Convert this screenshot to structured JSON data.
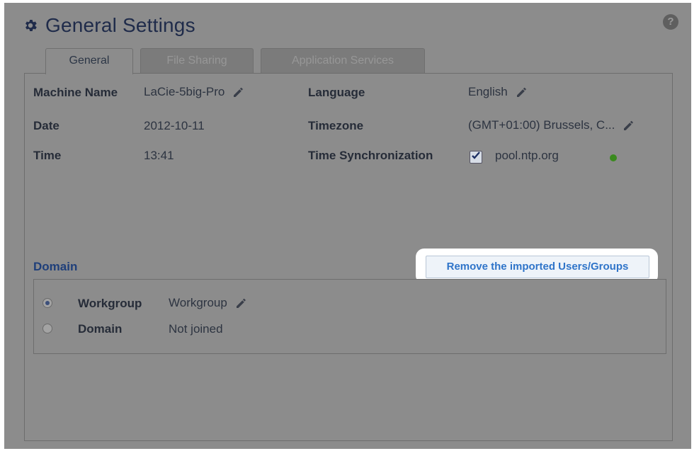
{
  "header": {
    "title": "General Settings",
    "help": "?"
  },
  "tabs": [
    {
      "label": "General",
      "active": true
    },
    {
      "label": "File Sharing",
      "active": false
    },
    {
      "label": "Application Services",
      "active": false
    }
  ],
  "fields": {
    "machine_name": {
      "label": "Machine Name",
      "value": "LaCie-5big-Pro"
    },
    "date": {
      "label": "Date",
      "value": "2012-10-11"
    },
    "time": {
      "label": "Time",
      "value": "13:41"
    },
    "language": {
      "label": "Language",
      "value": "English"
    },
    "timezone": {
      "label": "Timezone",
      "value": "(GMT+01:00) Brussels, C..."
    },
    "time_sync": {
      "label": "Time Synchronization",
      "checked": true,
      "server": "pool.ntp.org",
      "status_color": "#3a8a1e"
    }
  },
  "domain": {
    "title": "Domain",
    "remove_button": "Remove the imported Users/Groups",
    "options": [
      {
        "label": "Workgroup",
        "value": "Workgroup",
        "selected": true
      },
      {
        "label": "Domain",
        "value": "Not joined",
        "selected": false
      }
    ]
  }
}
